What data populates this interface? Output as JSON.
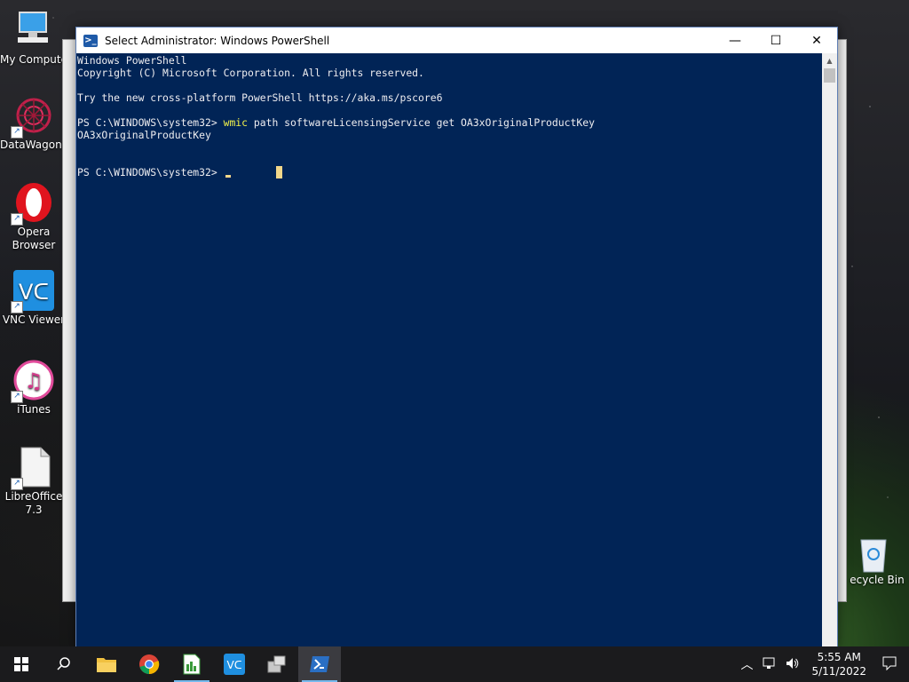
{
  "desktop": {
    "icons_left": [
      {
        "label": "My Compute",
        "icon": "computer-icon"
      },
      {
        "label": "DataWagon...",
        "icon": "datawagon-icon"
      },
      {
        "label": "Opera Browser",
        "icon": "opera-icon"
      },
      {
        "label": "VNC Viewer",
        "icon": "vnc-icon"
      },
      {
        "label": "iTunes",
        "icon": "itunes-icon"
      },
      {
        "label": "LibreOffice 7.3",
        "icon": "libreoffice-icon"
      }
    ],
    "recycle_bin_label": "ecycle Bin"
  },
  "window": {
    "title": "Select Administrator: Windows PowerShell",
    "minimize": "—",
    "maximize": "☐",
    "close": "✕"
  },
  "console": {
    "lines": [
      "Windows PowerShell",
      "Copyright (C) Microsoft Corporation. All rights reserved.",
      "",
      "Try the new cross-platform PowerShell https://aka.ms/pscore6",
      ""
    ],
    "prompt1": "PS C:\\WINDOWS\\system32> ",
    "command_name": "wmic",
    "command_args": " path softwareLicensingService get OA3xOriginalProductKey",
    "output": "OA3xOriginalProductKey",
    "prompt2": "PS C:\\WINDOWS\\system32> "
  },
  "taskbar": {
    "time": "5:55 AM",
    "date": "5/11/2022",
    "apps": [
      "file-explorer-icon",
      "chrome-icon",
      "libreoffice-calc-icon",
      "vnc-icon",
      "network-tool-icon",
      "powershell-icon"
    ]
  }
}
